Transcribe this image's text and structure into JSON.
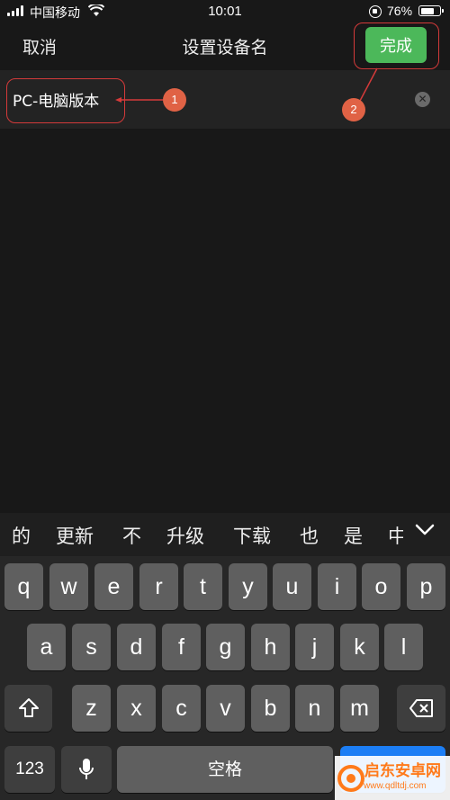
{
  "status_bar": {
    "carrier": "中国移动",
    "time": "10:01",
    "battery_percent": "76%",
    "battery_level": 0.76
  },
  "nav": {
    "cancel_label": "取消",
    "title": "设置设备名",
    "done_label": "完成"
  },
  "device_name_input": {
    "value": "PC-电脑版本"
  },
  "annotations": {
    "badge_1": "1",
    "badge_2": "2"
  },
  "suggestions": [
    "的",
    "更新",
    "不",
    "升级",
    "下载",
    "也",
    "是",
    "中"
  ],
  "keyboard": {
    "row1": [
      "q",
      "w",
      "e",
      "r",
      "t",
      "y",
      "u",
      "i",
      "o",
      "p"
    ],
    "row2": [
      "a",
      "s",
      "d",
      "f",
      "g",
      "h",
      "j",
      "k",
      "l"
    ],
    "row3": [
      "z",
      "x",
      "c",
      "v",
      "b",
      "n",
      "m"
    ],
    "numbers_label": "123",
    "space_label": "空格"
  },
  "watermark": {
    "name": "启东安卓网",
    "url": "www.qdltdj.com"
  },
  "colors": {
    "done_green": "#4cb85a",
    "annotation_red": "#d43a3a",
    "badge_orange": "#e06245"
  }
}
